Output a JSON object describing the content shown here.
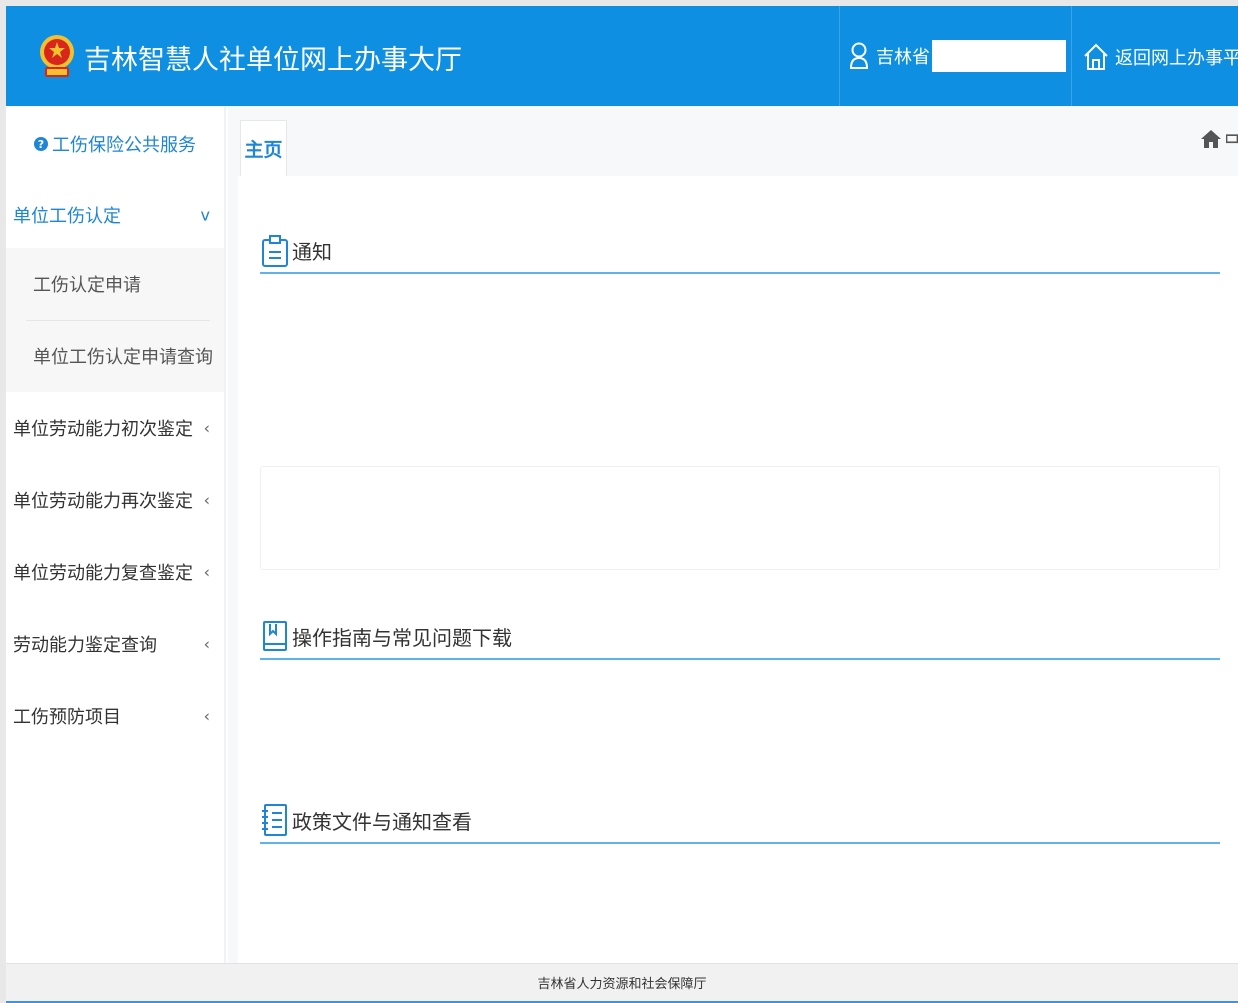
{
  "header": {
    "app_title": "吉林智慧人社单位网上办事大厅",
    "user_label": "吉林省",
    "return_label": "返回网上办事平台",
    "bg_color": "#0e8fe2"
  },
  "sidebar": {
    "title": "工伤保险公共服务",
    "groups": [
      {
        "label": "单位工伤认定",
        "expanded": true,
        "items": [
          {
            "label": "工伤认定申请"
          },
          {
            "label": "单位工伤认定申请查询"
          }
        ]
      },
      {
        "label": "单位劳动能力初次鉴定",
        "expanded": false
      },
      {
        "label": "单位劳动能力再次鉴定",
        "expanded": false
      },
      {
        "label": "单位劳动能力复查鉴定",
        "expanded": false
      },
      {
        "label": "劳动能力鉴定查询",
        "expanded": false
      },
      {
        "label": "工伤预防项目",
        "expanded": false
      }
    ],
    "expanded_arrow": "v",
    "collapsed_arrow": "‹"
  },
  "tabs": [
    {
      "label": "主页",
      "active": true
    }
  ],
  "sections": {
    "notice": {
      "title": "通知"
    },
    "guide": {
      "title": "操作指南与常见问题下载"
    },
    "policy": {
      "title": "政策文件与通知查看"
    }
  },
  "footer": {
    "text": "吉林省人力资源和社会保障厅"
  },
  "colors": {
    "accent": "#1f85d6",
    "header": "#0e8fe2",
    "section_line": "#5fb2ea"
  }
}
